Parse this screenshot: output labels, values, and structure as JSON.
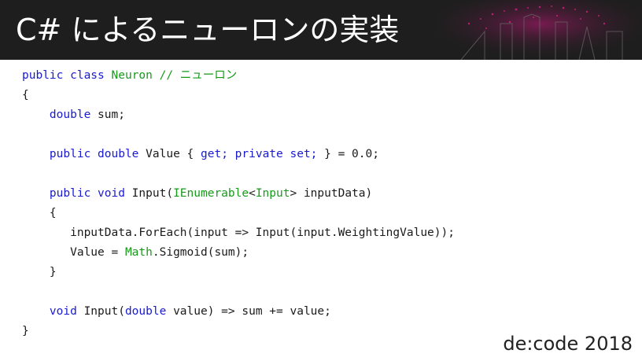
{
  "slide": {
    "title": "C# によるニューロンの実装",
    "brand": "de:code 2018"
  },
  "colors": {
    "header_bg": "#1e1e1e",
    "keyword": "#1a1ad0",
    "type": "#179a1a",
    "comment": "#179a1a",
    "text": "#1a1a1a"
  },
  "code": {
    "lines": [
      [
        [
          "kw",
          "public class "
        ],
        [
          "ty",
          "Neuron"
        ],
        [
          "cm",
          " // ニューロン"
        ]
      ],
      [
        [
          "tx",
          "{"
        ]
      ],
      [
        [
          "tx",
          "    "
        ],
        [
          "kw",
          "double"
        ],
        [
          "tx",
          " sum;"
        ]
      ],
      [],
      [
        [
          "tx",
          "    "
        ],
        [
          "kw",
          "public double"
        ],
        [
          "tx",
          " Value { "
        ],
        [
          "kw",
          "get; private set;"
        ],
        [
          "tx",
          " } = 0.0;"
        ]
      ],
      [],
      [
        [
          "tx",
          "    "
        ],
        [
          "kw",
          "public void"
        ],
        [
          "tx",
          " Input("
        ],
        [
          "ty",
          "IEnumerable"
        ],
        [
          "tx",
          "<"
        ],
        [
          "ty",
          "Input"
        ],
        [
          "tx",
          "> inputData)"
        ]
      ],
      [
        [
          "tx",
          "    {"
        ]
      ],
      [
        [
          "tx",
          "       inputData.ForEach(input => Input(input.WeightingValue));"
        ]
      ],
      [
        [
          "tx",
          "       Value = "
        ],
        [
          "ty",
          "Math"
        ],
        [
          "tx",
          ".Sigmoid(sum);"
        ]
      ],
      [
        [
          "tx",
          "    }"
        ]
      ],
      [],
      [
        [
          "tx",
          "    "
        ],
        [
          "kw",
          "void"
        ],
        [
          "tx",
          " Input("
        ],
        [
          "kw",
          "double"
        ],
        [
          "tx",
          " value) => sum += value;"
        ]
      ],
      [
        [
          "tx",
          "}"
        ]
      ]
    ]
  }
}
